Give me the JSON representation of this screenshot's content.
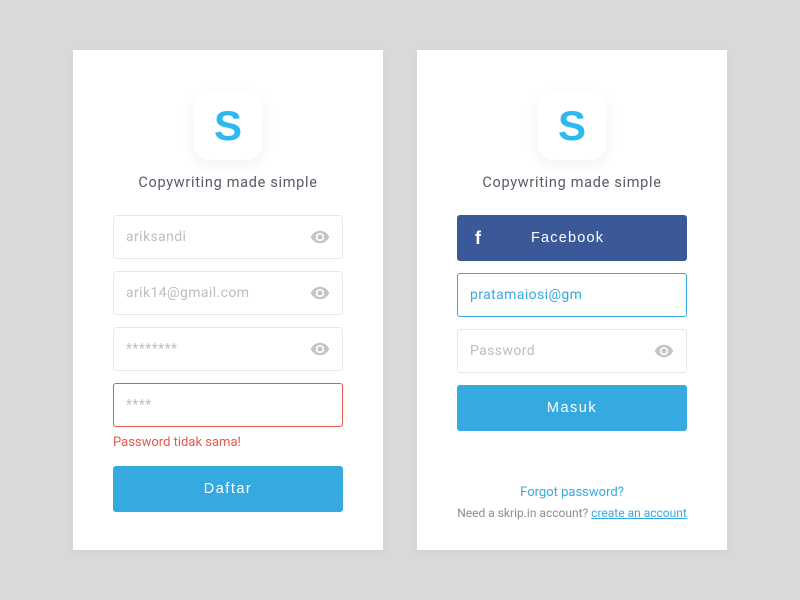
{
  "shared": {
    "tagline": "Copywriting made simple"
  },
  "signup": {
    "username": "ariksandi",
    "email": "arik14@gmail.com",
    "password": "********",
    "confirm": "****",
    "error_message": "Password tidak sama!",
    "submit_label": "Daftar"
  },
  "login": {
    "facebook_label": "Facebook",
    "email": "pratamaiosi@gm",
    "password_placeholder": "Password",
    "submit_label": "Masuk",
    "forgot_label": "Forgot password?",
    "need_text": "Need a skrip.in account? ",
    "create_label": "create an account"
  }
}
